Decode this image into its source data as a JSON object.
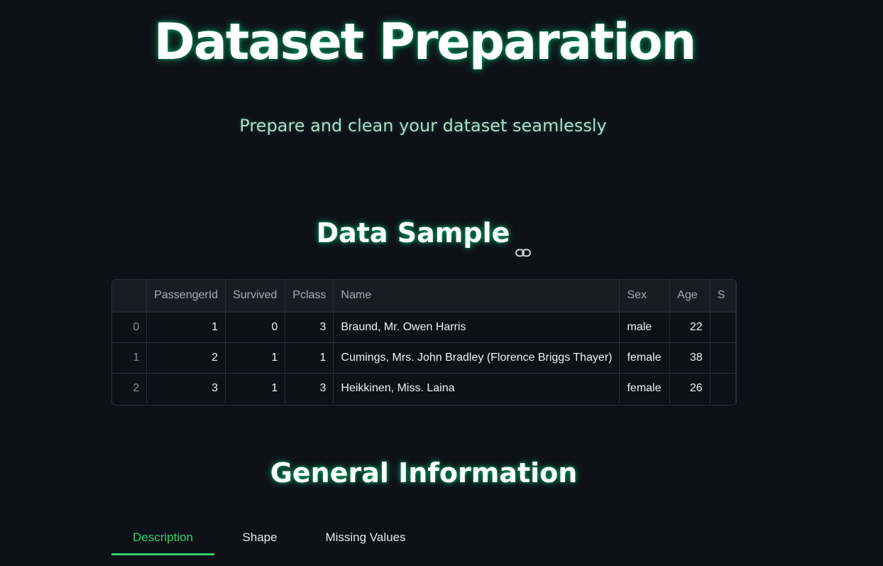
{
  "header": {
    "title": "Dataset Preparation",
    "subtitle": "Prepare and clean your dataset seamlessly"
  },
  "data_sample": {
    "heading": "Data Sample",
    "columns": [
      "",
      "PassengerId",
      "Survived",
      "Pclass",
      "Name",
      "Sex",
      "Age",
      "S"
    ],
    "rows": [
      [
        "0",
        "1",
        "0",
        "3",
        "Braund, Mr. Owen Harris",
        "male",
        "22",
        ""
      ],
      [
        "1",
        "2",
        "1",
        "1",
        "Cumings, Mrs. John Bradley (Florence Briggs Thayer)",
        "female",
        "38",
        ""
      ],
      [
        "2",
        "3",
        "1",
        "3",
        "Heikkinen, Miss. Laina",
        "female",
        "26",
        ""
      ]
    ]
  },
  "general_info": {
    "heading": "General Information",
    "tabs": [
      {
        "label": "Description",
        "active": true
      },
      {
        "label": "Shape",
        "active": false
      },
      {
        "label": "Missing Values",
        "active": false
      }
    ]
  },
  "colors": {
    "background": "#0e1117",
    "accent": "#2bd46a",
    "glow": "#00ff96"
  },
  "icons": {
    "heading_anchor": "link-icon"
  }
}
